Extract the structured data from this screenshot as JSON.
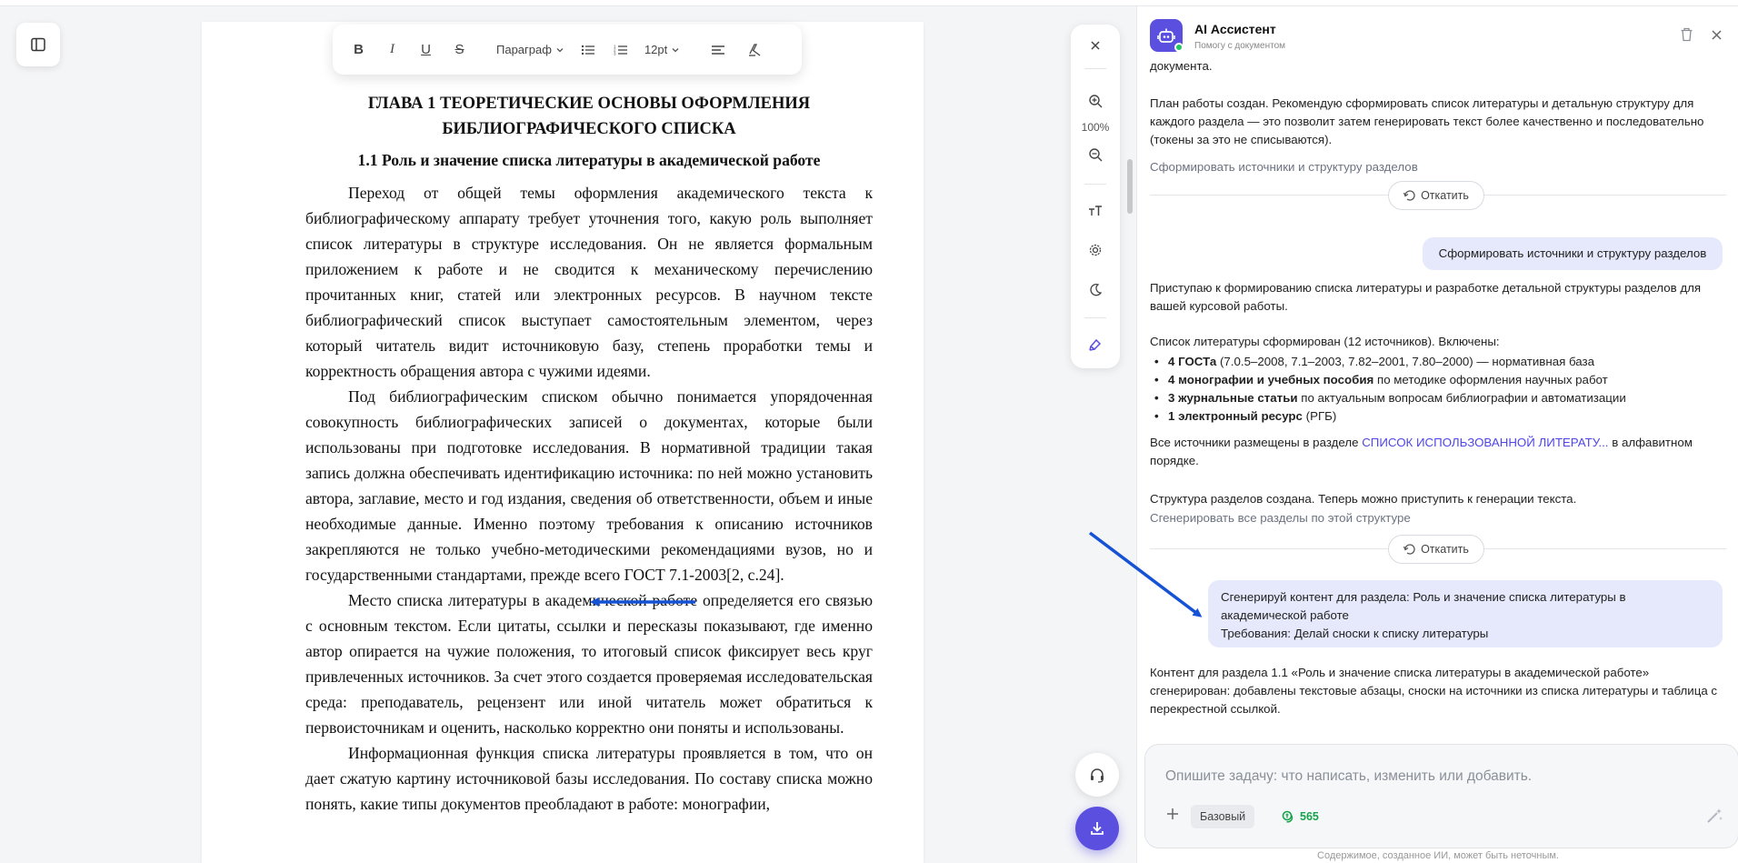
{
  "colors": {
    "accent": "#5b4fe0",
    "user_bubble": "#e6e9fb",
    "credits_green": "#16a34a",
    "annotation_arrow": "#1552d6"
  },
  "toolbar": {
    "bold": "B",
    "italic": "I",
    "underline": "U",
    "strike": "S",
    "style_select": "Параграф",
    "font_size": "12pt",
    "icons": [
      "bullet-list-icon",
      "numbered-list-icon",
      "align-icon",
      "clear-format-icon",
      "chevron-down-icon"
    ]
  },
  "rail": {
    "zoom_level": "100%",
    "icons": [
      "close-icon",
      "zoom-in-icon",
      "zoom-out-icon",
      "text-size-icon",
      "gear-icon",
      "moon-icon",
      "highlighter-icon"
    ]
  },
  "document": {
    "chapter_title_line1": "ГЛАВА 1 ТЕОРЕТИЧЕСКИЕ ОСНОВЫ ОФОРМЛЕНИЯ",
    "chapter_title_line2": "БИБЛИОГРАФИЧЕСКОГО СПИСКА",
    "section_title": "1.1 Роль и значение списка литературы в академической работе",
    "paragraphs": [
      "Переход от общей темы оформления академического текста к библиографическому аппарату требует уточнения того, какую роль выполняет список литературы в структуре исследования. Он не является формальным приложением к работе и не сводится к механическому перечислению прочитанных книг, статей или электронных ресурсов. В научном тексте библиографический список выступает самостоятельным элементом, через который читатель видит источниковую базу, степень проработки темы и корректность обращения автора с чужими идеями.",
      "Под библиографическим списком обычно понимается упорядоченная совокупность библиографических записей о документах, которые были использованы при подготовке исследования. В нормативной традиции такая запись должна обеспечивать идентификацию источника: по ней можно установить автора, заглавие, место и год издания, сведения об ответственности, объем и иные необходимые данные. Именно поэтому требования к описанию источников закрепляются не только учебно-методическими рекомендациями вузов, но и государственными стандартами, прежде всего ГОСТ 7.1-2003[2, с.24].",
      "Место списка литературы в академической работе определяется его связью с основным текстом. Если цитаты, ссылки и пересказы показывают, где именно автор опирается на чужие положения, то итоговый список фиксирует весь круг привлеченных источников. За счет этого создается проверяемая исследовательская среда: преподаватель, рецензент или иной читатель может обратиться к первоисточникам и оценить, насколько корректно они поняты и использованы.",
      "Информационная функция списка литературы проявляется в том, что он дает сжатую картину источниковой базы исследования. По составу списка можно понять, какие типы документов преобладают в работе: монографии,"
    ]
  },
  "assistant": {
    "title": "AI Ассистент",
    "subtitle": "Помогу с документом",
    "header_icons": [
      "bot-icon",
      "trash-icon",
      "close-icon"
    ],
    "msg_top_cut": "документа.",
    "msg_plan": "План работы создан. Рекомендую сформировать список литературы и детальную структуру для каждого раздела — это позволит затем генерировать текст более качественно и последовательно (токены за это не списываются).",
    "suggest_1": "Сформировать источники и структуру разделов",
    "rollback_label": "Откатить",
    "user_msg_1": "Сформировать источники и структуру разделов",
    "msg_start": "Приступаю к формированию списка литературы и разработке детальной структуры разделов для вашей курсовой работы.",
    "msg_list_intro": "Список литературы сформирован (12 источников). Включены:",
    "list": [
      {
        "bold": "4 ГОСТа",
        "rest": " (7.0.5–2008, 7.1–2003, 7.82–2001, 7.80–2000) — нормативная база"
      },
      {
        "bold": "4 монографии и учебных пособия",
        "rest": " по методике оформления научных работ"
      },
      {
        "bold": "3 журнальные статьи",
        "rest": " по актуальным вопросам библиографии и автоматизации"
      },
      {
        "bold": "1 электронный ресурс",
        "rest": " (РГБ)"
      }
    ],
    "msg_sources_prefix": "Все источники размещены в разделе ",
    "msg_sources_link": "СПИСОК ИСПОЛЬЗОВАННОЙ ЛИТЕРАТУ...",
    "msg_sources_suffix": " в алфавитном порядке.",
    "msg_structure": "Структура разделов создана. Теперь можно приступить к генерации текста.",
    "suggest_2": "Сгенерировать все разделы по этой структуре",
    "user_msg_2_line1": "Сгенерируй контент для раздела: Роль и значение списка литературы в академической работе",
    "user_msg_2_line2": "Требования: Делай сноски к списку литературы",
    "msg_result": "Контент для раздела 1.1 «Роль и значение списка литературы в академической работе» сгенерирован: добавлены текстовые абзацы, сноски на источники из списка литературы и таблица с перекрестной ссылкой.",
    "composer_placeholder": "Опишите задачу: что написать, изменить или добавить.",
    "mode_label": "Базовый",
    "credits": "565",
    "disclaimer": "Содержимое, созданное ИИ, может быть неточным."
  }
}
